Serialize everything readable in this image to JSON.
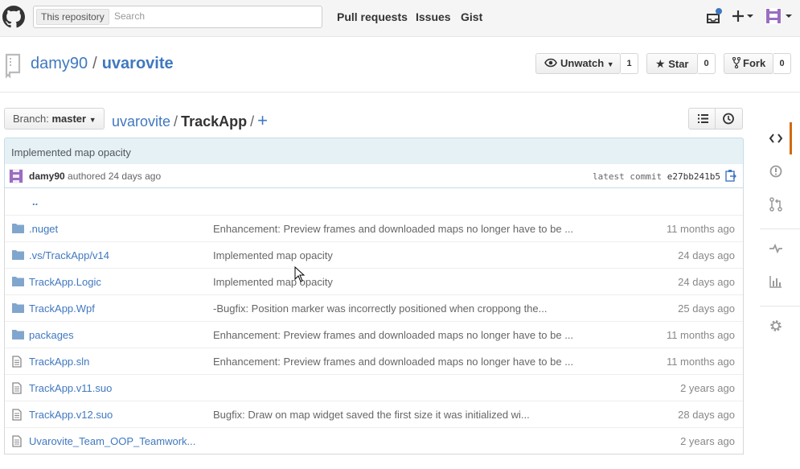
{
  "header": {
    "search_scope": "This repository",
    "search_placeholder": "Search",
    "nav": [
      "Pull requests",
      "Issues",
      "Gist"
    ]
  },
  "repo": {
    "owner": "damy90",
    "separator": "/",
    "name": "uvarovite",
    "watch_label": "Unwatch",
    "watch_count": "1",
    "star_label": "Star",
    "star_count": "0",
    "fork_label": "Fork",
    "fork_count": "0"
  },
  "filenav": {
    "branch_prefix": "Branch:",
    "branch": "master",
    "root": "uvarovite",
    "current": "TrackApp",
    "add": "+"
  },
  "commit": {
    "message": "Implemented map opacity",
    "author": "damy90",
    "authored": "authored 24 days ago",
    "latest_label": "latest commit",
    "sha": "e27bb241b5"
  },
  "files": [
    {
      "type": "up",
      "name": "..",
      "message": "",
      "age": ""
    },
    {
      "type": "dir",
      "name": ".nuget",
      "message": "Enhancement: Preview frames and downloaded maps no longer have to be ...",
      "age": "11 months ago"
    },
    {
      "type": "dir",
      "name": ".vs/TrackApp/v14",
      "message": "Implemented map opacity",
      "age": "24 days ago"
    },
    {
      "type": "dir",
      "name": "TrackApp.Logic",
      "message": "Implemented map opacity",
      "age": "24 days ago"
    },
    {
      "type": "dir",
      "name": "TrackApp.Wpf",
      "message": "-Bugfix: Position marker was incorrectly positioned when croppong the...",
      "age": "25 days ago"
    },
    {
      "type": "dir",
      "name": "packages",
      "message": "Enhancement: Preview frames and downloaded maps no longer have to be ...",
      "age": "11 months ago"
    },
    {
      "type": "file",
      "name": "TrackApp.sln",
      "message": "Enhancement: Preview frames and downloaded maps no longer have to be ...",
      "age": "11 months ago"
    },
    {
      "type": "file",
      "name": "TrackApp.v11.suo",
      "message": "",
      "age": "2 years ago"
    },
    {
      "type": "file",
      "name": "TrackApp.v12.suo",
      "message": "Bugfix: Draw on map widget saved the first size it was initialized wi...",
      "age": "28 days ago"
    },
    {
      "type": "file",
      "name": "Uvarovite_Team_OOP_Teamwork...",
      "message": "",
      "age": "2 years ago"
    }
  ],
  "sidebar": [
    "code-icon",
    "issues-icon",
    "pull-requests-icon",
    "pulse-icon",
    "graphs-icon",
    "settings-icon"
  ],
  "colors": {
    "link": "#4078c0",
    "commit_bg": "#e6f1f6",
    "folder": "#80a6cd",
    "active_tab": "#d26911"
  }
}
